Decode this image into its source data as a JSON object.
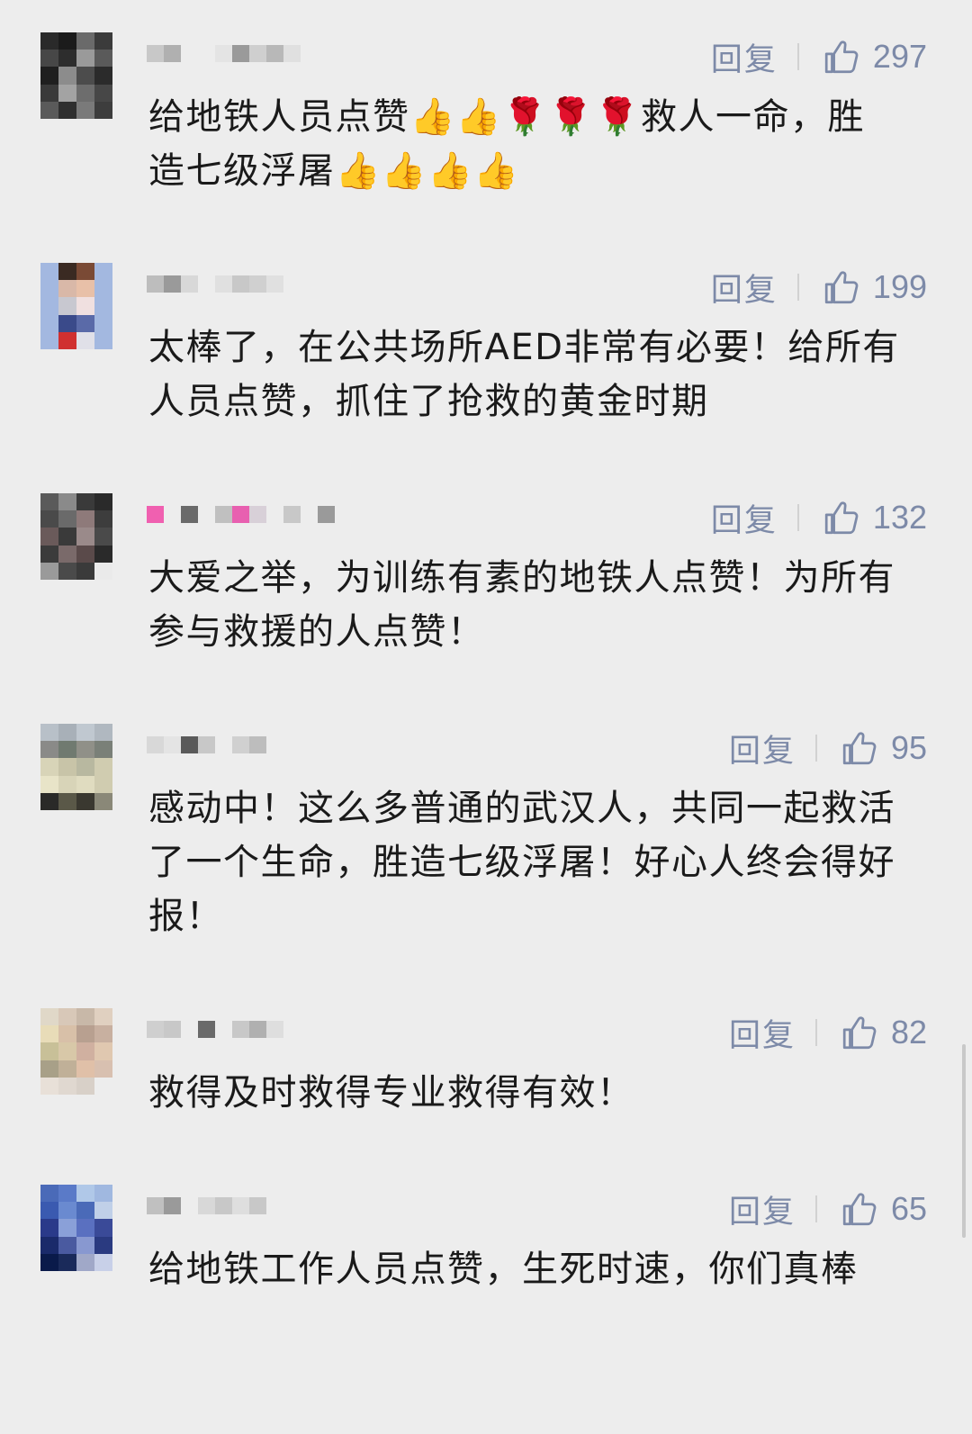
{
  "reply_label": "回复",
  "colors": {
    "link": "#7d8aa8",
    "text": "#1a1a1a",
    "background": "#ededed"
  },
  "comments": [
    {
      "avatar_pixels": [
        "#2a2a2a",
        "#1b1b1b",
        "#6a6a6a",
        "#3b3b3b",
        "#474747",
        "#2d2d2d",
        "#9a9a9a",
        "#5a5a5a",
        "#1f1f1f",
        "#8c8c8c",
        "#4c4c4c",
        "#2b2b2b",
        "#3a3a3a",
        "#a3a3a3",
        "#6d6d6d",
        "#474747",
        "#5a5a5a",
        "#2f2f2f",
        "#7a7a7a",
        "#3d3d3d"
      ],
      "text": "给地铁人员点赞👍👍🌹🌹🌹救人一命，胜造七级浮屠👍👍👍👍",
      "likes": "297"
    },
    {
      "avatar_pixels": [
        "#a3b8e0",
        "#3a2a22",
        "#7a4a35",
        "#a3b8e0",
        "#a3b8e0",
        "#d9b8a8",
        "#e8c0a8",
        "#a3b8e0",
        "#a3b8e0",
        "#c8c8d0",
        "#f0e0e0",
        "#a3b8e0",
        "#a3b8e0",
        "#3a4a8a",
        "#5a6aa8",
        "#a3b8e0",
        "#a3b8e0",
        "#d03030",
        "#e0e0e8",
        "#a3b8e0"
      ],
      "text": "太棒了，在公共场所AED非常有必要！给所有人员点赞，抓住了抢救的黄金时期",
      "likes": "199"
    },
    {
      "avatar_pixels": [
        "#5a5a5a",
        "#8a8a8a",
        "#3a3a3a",
        "#2a2a2a",
        "#4a4a4a",
        "#6a6a6a",
        "#8e7a7a",
        "#3d3d3d",
        "#6a5a5a",
        "#3a3a3a",
        "#9a8a8a",
        "#4a4a4a",
        "#3b3b3b",
        "#7a6a6a",
        "#5a4a4a",
        "#2a2a2a",
        "#9a9a9a",
        "#4a4a4a",
        "#3a3a3a",
        "#eaeaea"
      ],
      "text": "大爱之举，为训练有素的地铁人点赞！为所有参与救援的人点赞！",
      "likes": "132"
    },
    {
      "avatar_pixels": [
        "#b8c0c8",
        "#a8b0b8",
        "#c0c8d0",
        "#b0b8c0",
        "#8a8a88",
        "#707a70",
        "#909088",
        "#7a8078",
        "#d8d4b8",
        "#c8c4a8",
        "#b8b8a0",
        "#d0ccb0",
        "#e8e4c8",
        "#d8d4b8",
        "#e0dcc0",
        "#d0ccb0",
        "#2a2a28",
        "#5a5848",
        "#3a3830",
        "#8a8878"
      ],
      "text": "感动中！这么多普通的武汉人，共同一起救活了一个生命，胜造七级浮屠！好心人终会得好报！",
      "likes": "95"
    },
    {
      "avatar_pixels": [
        "#e0d8c8",
        "#d8c8b8",
        "#c8b8a8",
        "#e0d0c0",
        "#e8dcb8",
        "#d8c0a8",
        "#b8a090",
        "#c8b0a0",
        "#c8c098",
        "#d8c8a8",
        "#d0b0a0",
        "#e0c8b0",
        "#a8a088",
        "#c0b098",
        "#e0c0a8",
        "#d8c0b0",
        "#e8e0d8",
        "#e0d8d0",
        "#d8d0c8",
        "#ededed"
      ],
      "text": "救得及时救得专业救得有效！",
      "likes": "82"
    },
    {
      "avatar_pixels": [
        "#4a6ab8",
        "#5a7ac8",
        "#b0c8e8",
        "#a0b8e0",
        "#3a5ab0",
        "#6a8ad0",
        "#4a6ab8",
        "#c0d0e8",
        "#2a3a8a",
        "#8aa0d8",
        "#5a70c0",
        "#3a4a98",
        "#1a2a6a",
        "#4a5aa0",
        "#8898d0",
        "#2a3a80",
        "#0a1a4a",
        "#1a2a5a",
        "#a0a8c8",
        "#c8d0e8"
      ],
      "text": "给地铁工作人员点赞，生死时速，你们真棒",
      "likes": "65"
    }
  ]
}
